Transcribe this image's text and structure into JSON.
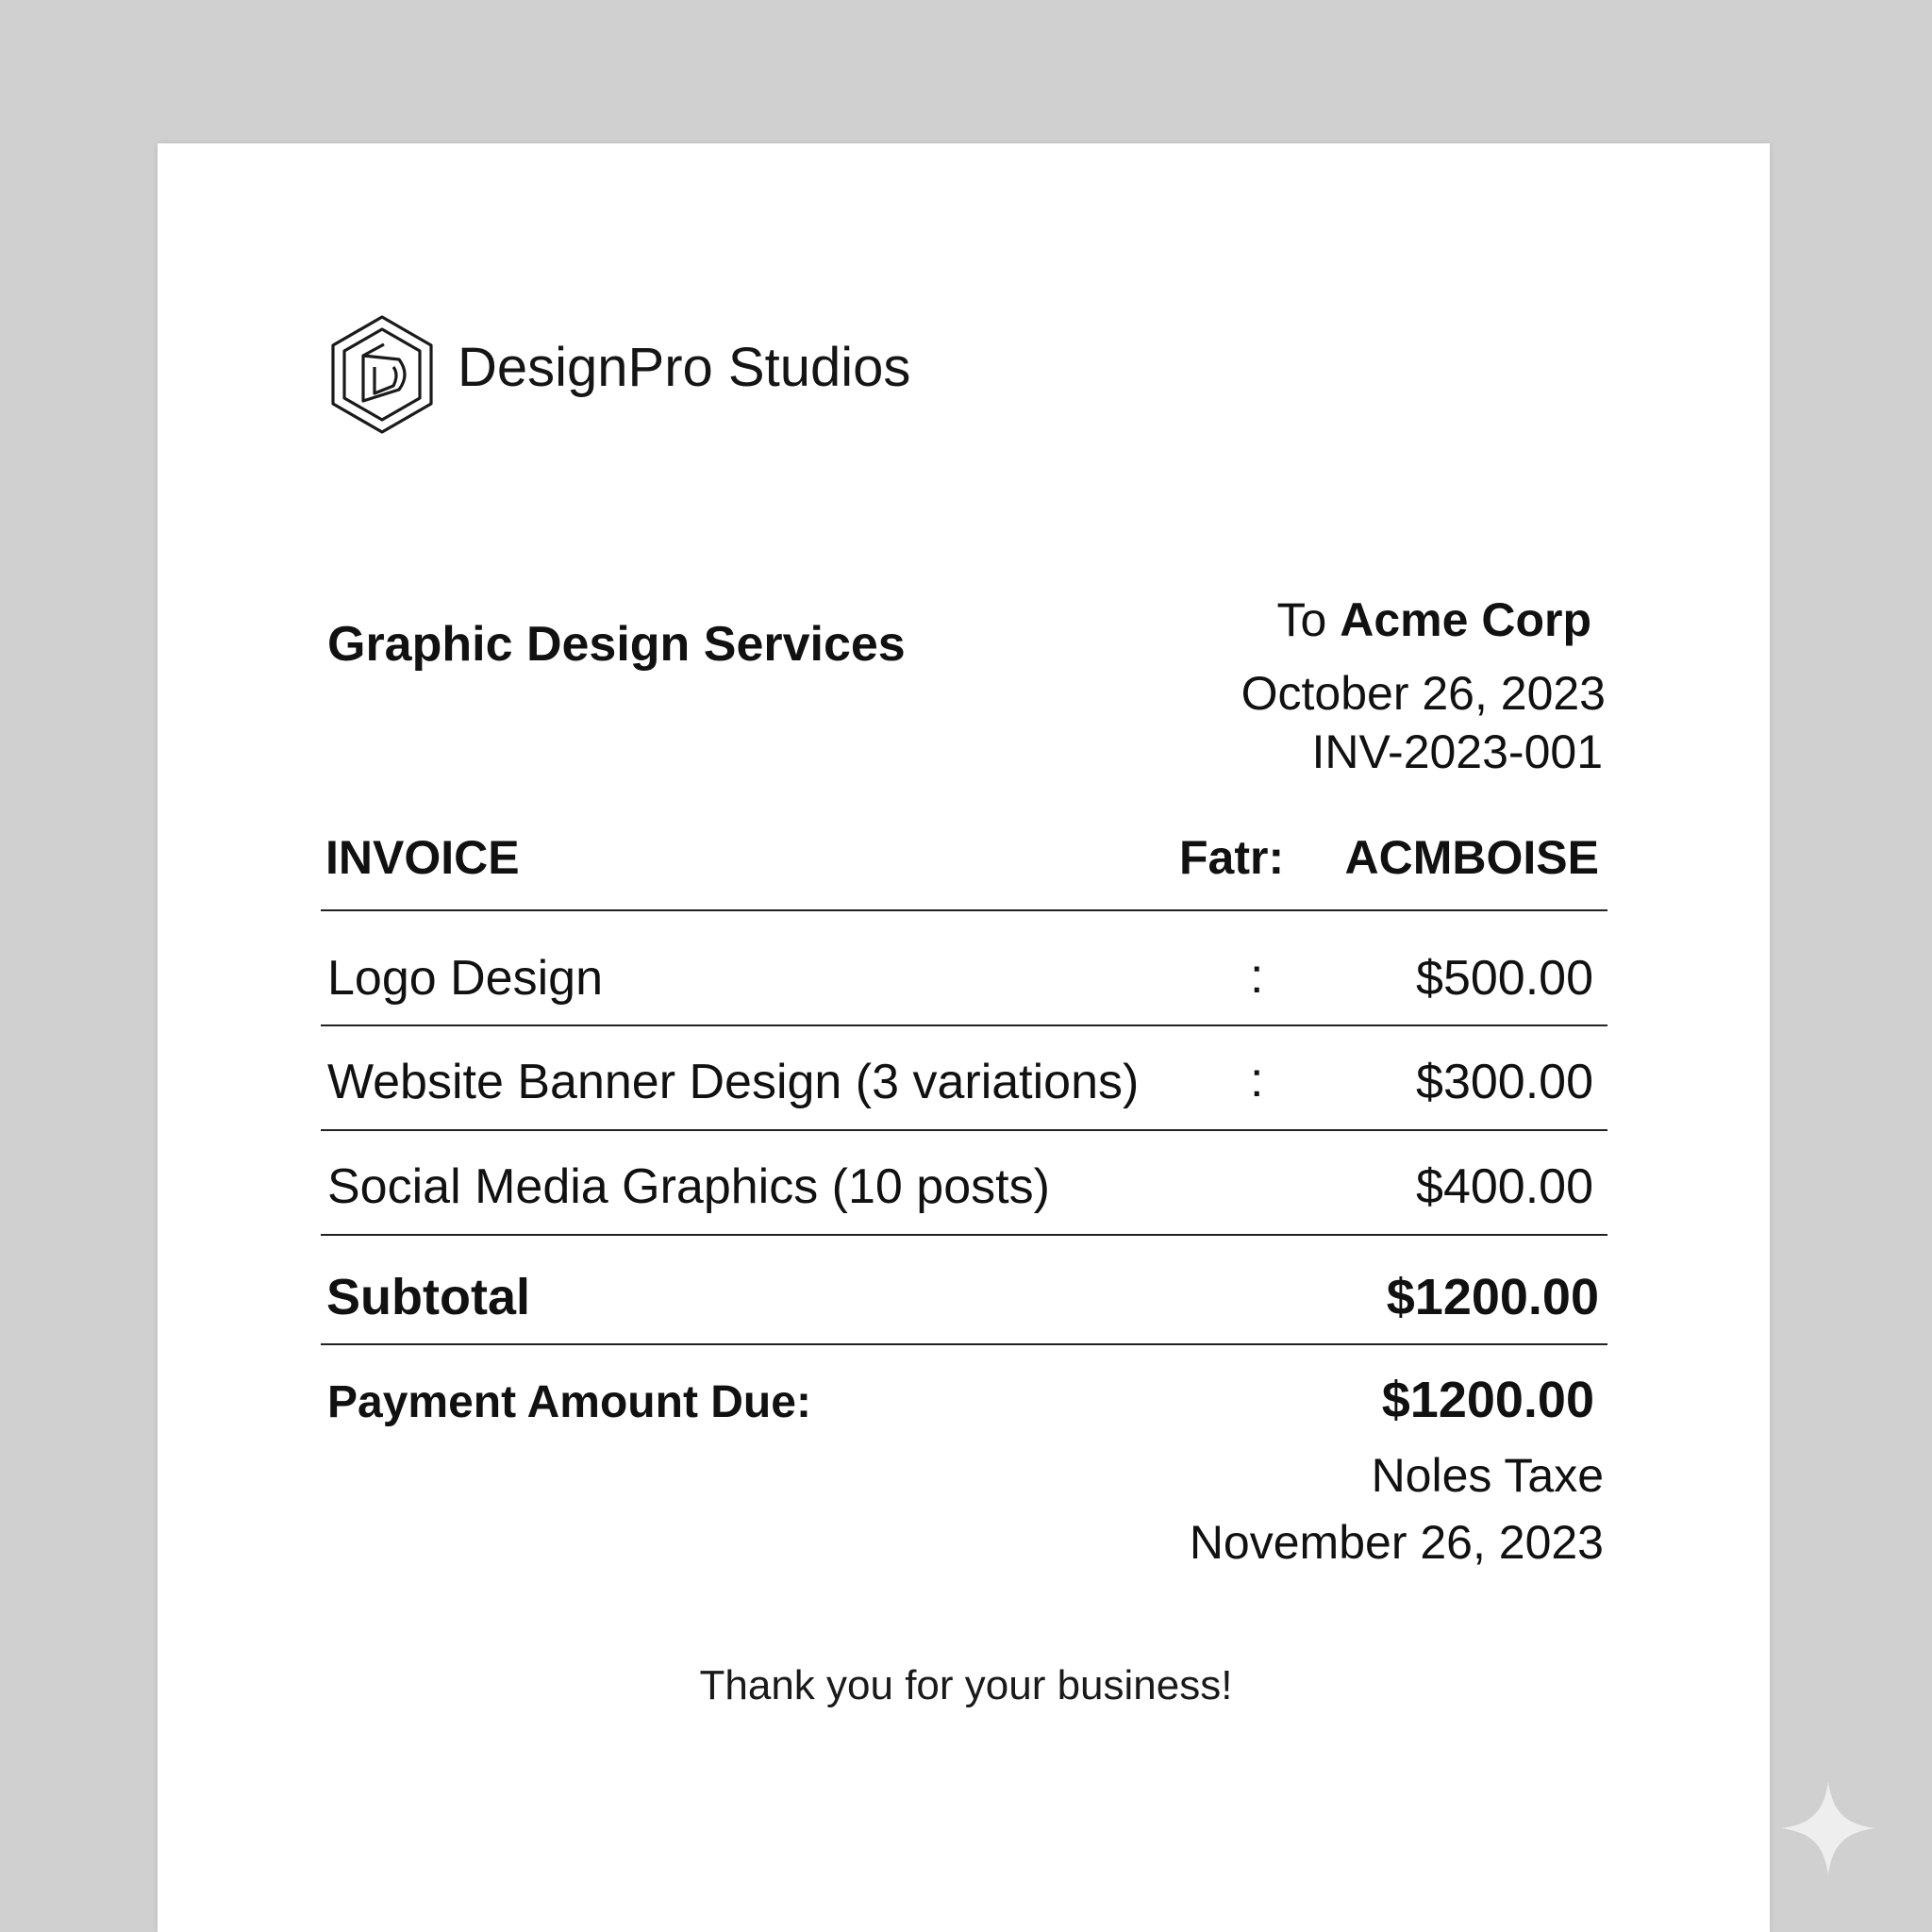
{
  "company": {
    "name": "DesignPro Studios",
    "logo_icon": "hexagon-d-logo-icon"
  },
  "invoice": {
    "services_title": "Graphic Design Services",
    "to_prefix": "To",
    "client": "Acme Corp",
    "date": "October 26, 2023",
    "number": "INV-2023-001",
    "heading": "INVOICE",
    "header_label": "Fatr:",
    "header_code": "ACMBOISE"
  },
  "items": [
    {
      "description": "Logo Design",
      "separator": ":",
      "amount": "$500.00"
    },
    {
      "description": "Website Banner Design (3 variations)",
      "separator": ":",
      "amount": "$300.00"
    },
    {
      "description": "Social Media Graphics (10 posts)",
      "separator": "",
      "amount": "$400.00"
    }
  ],
  "totals": {
    "subtotal_label": "Subtotal",
    "subtotal_value": "$1200.00",
    "due_label": "Payment Amount Due:",
    "due_value": "$1200.00",
    "tax_note": "Noles Taxe",
    "due_date": "November 26, 2023"
  },
  "footer": {
    "thanks": "Thank you for your business!"
  },
  "colors": {
    "background": "#d0d0d0",
    "paper": "#ffffff",
    "text": "#111111"
  },
  "decor": {
    "corner_icon": "sparkle-icon"
  }
}
